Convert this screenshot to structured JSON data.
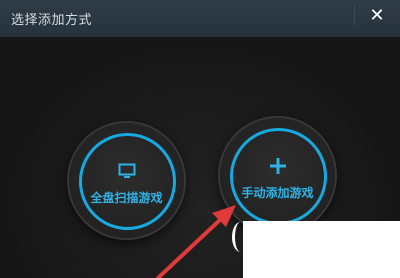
{
  "dialog": {
    "title": "选择添加方式",
    "close_label": "✕"
  },
  "options": [
    {
      "label": "全盘扫描游戏",
      "icon": "monitor-icon"
    },
    {
      "label": "手动添加游戏",
      "icon": "plus-icon"
    }
  ],
  "colors": {
    "accent": "#18a9e0",
    "titlebar": "#2b3843",
    "background": "#1a1a1a",
    "annotation_arrow": "#e03a3a"
  }
}
